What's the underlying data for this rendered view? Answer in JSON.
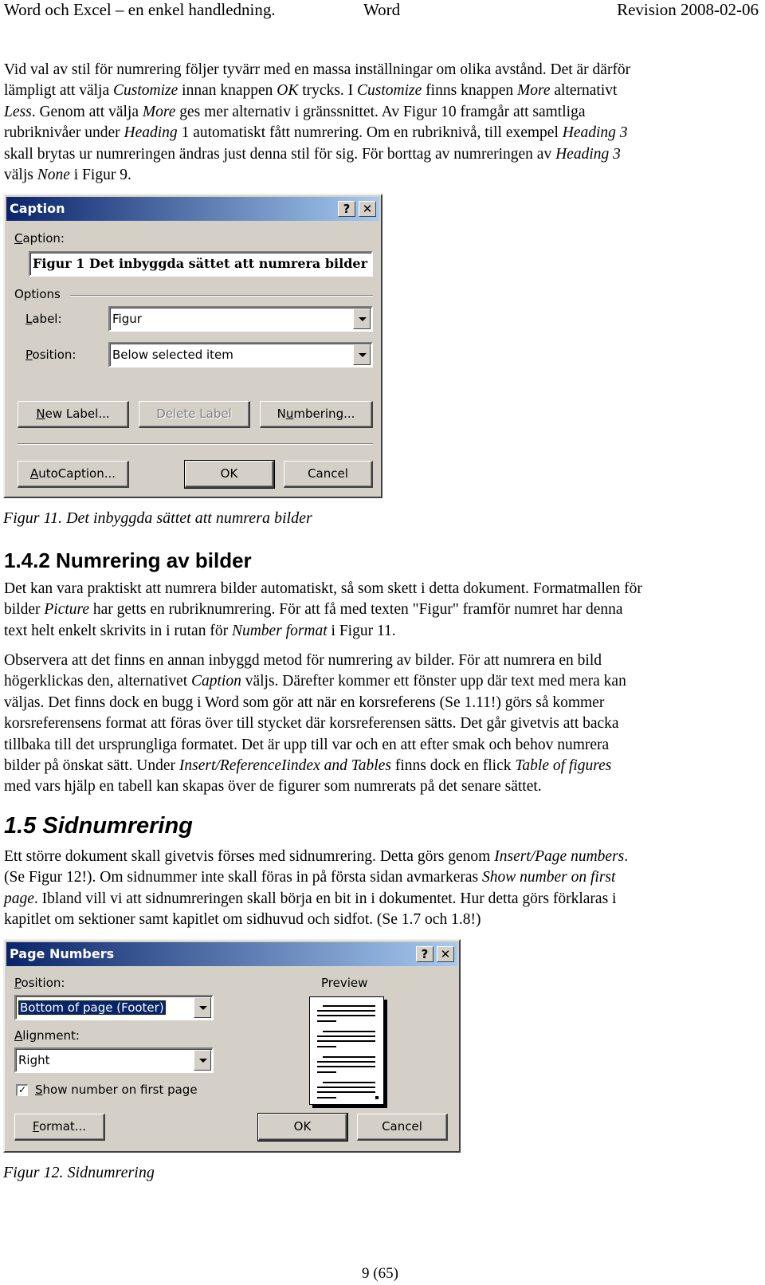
{
  "header": {
    "left": "Word och Excel – en enkel handledning.",
    "center": "Word",
    "right": "Revision 2008-02-06"
  },
  "intro": {
    "lines": [
      [
        "Vid val av stil för numrering följer tyvärr med en massa inställningar om olika avstånd. Det är därför"
      ],
      [
        "lämpligt att välja ",
        {
          "i": "Customize"
        },
        " innan knappen ",
        {
          "i": "OK"
        },
        " trycks. I ",
        {
          "i": "Customize"
        },
        " finns knappen ",
        {
          "i": "More"
        },
        " alternativt"
      ],
      [
        {
          "i": "Less"
        },
        ". Genom att välja ",
        {
          "i": "More"
        },
        " ges mer alternativ i gränssnittet. Av Figur 10 framgår att samtliga"
      ],
      [
        "rubriknivåer under ",
        {
          "i": "Heading"
        },
        " 1 automatiskt fått numrering. Om en rubriknivå, till exempel ",
        {
          "i": "Heading 3"
        }
      ],
      [
        "skall brytas ur numreringen ändras just denna stil för sig. För borttag av numreringen av ",
        {
          "i": "Heading 3"
        }
      ],
      [
        "väljs ",
        {
          "i": "None"
        },
        " i Figur 9."
      ]
    ]
  },
  "caption_dialog": {
    "title": "Caption",
    "help_btn": "?",
    "close_btn": "✕",
    "caption_label": "Caption:",
    "caption_label_accel": "C",
    "caption_value": "Figur 1 Det inbyggda sättet att numrera bilder",
    "options_label": "Options",
    "label_label": "Label:",
    "label_value": "Figur",
    "position_label": "Position:",
    "position_value": "Below selected item",
    "new_label_btn": "New Label...",
    "delete_label_btn": "Delete Label",
    "numbering_btn": "Numbering...",
    "autocaption_btn": "AutoCaption...",
    "ok_btn": "OK",
    "cancel_btn": "Cancel"
  },
  "figure11_caption": "Figur 11. Det inbyggda sättet att numrera bilder",
  "section_142": {
    "heading": "1.4.2 Numrering av bilder",
    "para1": [
      [
        "Det kan vara praktiskt att numrera bilder automatiskt, så som skett i detta dokument. Formatmallen för"
      ],
      [
        "bilder ",
        {
          "i": "Picture"
        },
        " har getts en rubriknumrering. För att få med texten \"Figur\" framför numret har denna"
      ],
      [
        "text helt enkelt skrivits in i rutan för ",
        {
          "i": "Number format"
        },
        " i Figur 11."
      ]
    ],
    "para2": [
      [
        "Observera att det finns en annan inbyggd metod för numrering av bilder. För att numrera en bild"
      ],
      [
        "högerklickas den, alternativet ",
        {
          "i": "Caption"
        },
        " väljs. Därefter kommer ett fönster upp där text med mera kan"
      ],
      [
        "väljas. Det finns dock en bugg i Word som gör att när en korsreferens (Se 1.11!) görs så kommer"
      ],
      [
        "korsreferensens format att föras över till stycket där korsreferensen sätts. Det går givetvis att backa"
      ],
      [
        "tillbaka till det ursprungliga formatet. Det är upp till var och en att efter smak och behov numrera"
      ],
      [
        "bilder på önskat sätt. Under ",
        {
          "i": "Insert/ReferenceIindex and Tables"
        },
        " finns dock en flick ",
        {
          "i": "Table of figures"
        }
      ],
      [
        "med vars hjälp en tabell kan skapas över de figurer som numrerats på det senare sättet."
      ]
    ]
  },
  "section_15": {
    "heading": "1.5 Sidnumrering",
    "para": [
      [
        "Ett större dokument skall givetvis förses med sidnumrering. Detta görs genom ",
        {
          "i": "Insert/Page numbers"
        },
        "."
      ],
      [
        "(Se Figur 12!). Om sidnummer inte skall föras in på första sidan avmarkeras ",
        {
          "i": "Show number on first"
        }
      ],
      [
        {
          "i": "page"
        },
        ". Ibland vill vi att sidnumreringen skall börja en bit in i dokumentet. Hur detta görs förklaras i"
      ],
      [
        "kapitlet om sektioner samt kapitlet om sidhuvud och sidfot. (Se 1.7 och 1.8!)"
      ]
    ]
  },
  "pagenum_dialog": {
    "title": "Page Numbers",
    "help_btn": "?",
    "close_btn": "✕",
    "position_label": "Position:",
    "position_value": "Bottom of page (Footer)",
    "alignment_label": "Alignment:",
    "alignment_value": "Right",
    "show_first_label": "Show number on first page",
    "show_first_checked": true,
    "preview_label": "Preview",
    "format_btn": "Format...",
    "ok_btn": "OK",
    "cancel_btn": "Cancel"
  },
  "figure12_caption": "Figur 12. Sidnumrering",
  "footer": {
    "page": "9 (65)"
  }
}
